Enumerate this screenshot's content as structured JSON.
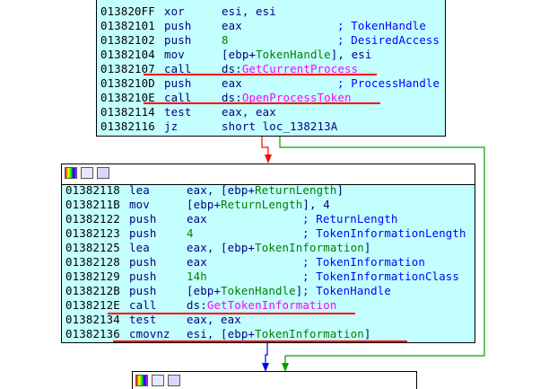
{
  "block1": {
    "lines": [
      {
        "addr": "013820FF",
        "mnem": "xor",
        "ops": "esi, esi",
        "comment": ""
      },
      {
        "addr": "01382101",
        "mnem": "push",
        "ops": "eax",
        "comment": "; TokenHandle"
      },
      {
        "addr": "01382102",
        "mnem": "push",
        "ops": "8",
        "comment": "; DesiredAccess"
      },
      {
        "addr": "01382104",
        "mnem": "mov",
        "ops_pre": "[ebp+",
        "ops_sym": "TokenHandle",
        "ops_post": "], esi",
        "comment": ""
      },
      {
        "addr": "01382107",
        "mnem": "call",
        "ops_pre": "ds:",
        "ops_api": "GetCurrentProcess",
        "comment": ""
      },
      {
        "addr": "0138210D",
        "mnem": "push",
        "ops": "eax",
        "comment": "; ProcessHandle"
      },
      {
        "addr": "0138210E",
        "mnem": "call",
        "ops_pre": "ds:",
        "ops_api": "OpenProcessToken",
        "comment": ""
      },
      {
        "addr": "01382114",
        "mnem": "test",
        "ops": "eax, eax",
        "comment": ""
      },
      {
        "addr": "01382116",
        "mnem": "jz",
        "ops": "short loc_138213A",
        "comment": ""
      }
    ]
  },
  "block2": {
    "lines": [
      {
        "addr": "01382118",
        "mnem": "lea",
        "ops_pre": "eax, [ebp+",
        "ops_sym": "ReturnLength",
        "ops_post": "]",
        "comment": ""
      },
      {
        "addr": "0138211B",
        "mnem": "mov",
        "ops_pre": "[ebp+",
        "ops_sym": "ReturnLength",
        "ops_post": "], 4",
        "comment": ""
      },
      {
        "addr": "01382122",
        "mnem": "push",
        "ops": "eax",
        "comment": "; ReturnLength"
      },
      {
        "addr": "01382123",
        "mnem": "push",
        "ops": "4",
        "comment": "; TokenInformationLength"
      },
      {
        "addr": "01382125",
        "mnem": "lea",
        "ops_pre": "eax, [ebp+",
        "ops_sym": "TokenInformation",
        "ops_post": "]",
        "comment": ""
      },
      {
        "addr": "01382128",
        "mnem": "push",
        "ops": "eax",
        "comment": "; TokenInformation"
      },
      {
        "addr": "01382129",
        "mnem": "push",
        "ops": "14h",
        "comment": "; TokenInformationClass"
      },
      {
        "addr": "0138212B",
        "mnem": "push",
        "ops_pre": "[ebp+",
        "ops_sym": "TokenHandle",
        "ops_post": "]",
        "comment": "; TokenHandle"
      },
      {
        "addr": "0138212E",
        "mnem": "call",
        "ops_pre": "ds:",
        "ops_api": "GetTokenInformation",
        "comment": ""
      },
      {
        "addr": "01382134",
        "mnem": "test",
        "ops": "eax, eax",
        "comment": ""
      },
      {
        "addr": "01382136",
        "mnem": "cmovnz",
        "ops_pre": "esi, [ebp+",
        "ops_sym": "TokenInformation",
        "ops_post": "]",
        "comment": ""
      }
    ]
  },
  "colors": {
    "node_bg": "#c4ffff",
    "api": "#ff00ff",
    "comment": "#0000ff",
    "symbol": "#008000",
    "annotation_red": "#ff0000",
    "edge_true": "#ff0000",
    "edge_false": "#00aa00",
    "edge_next": "#0000ff"
  },
  "icons": [
    "graph-colors-icon",
    "edit-node-icon",
    "graph-overview-icon"
  ]
}
